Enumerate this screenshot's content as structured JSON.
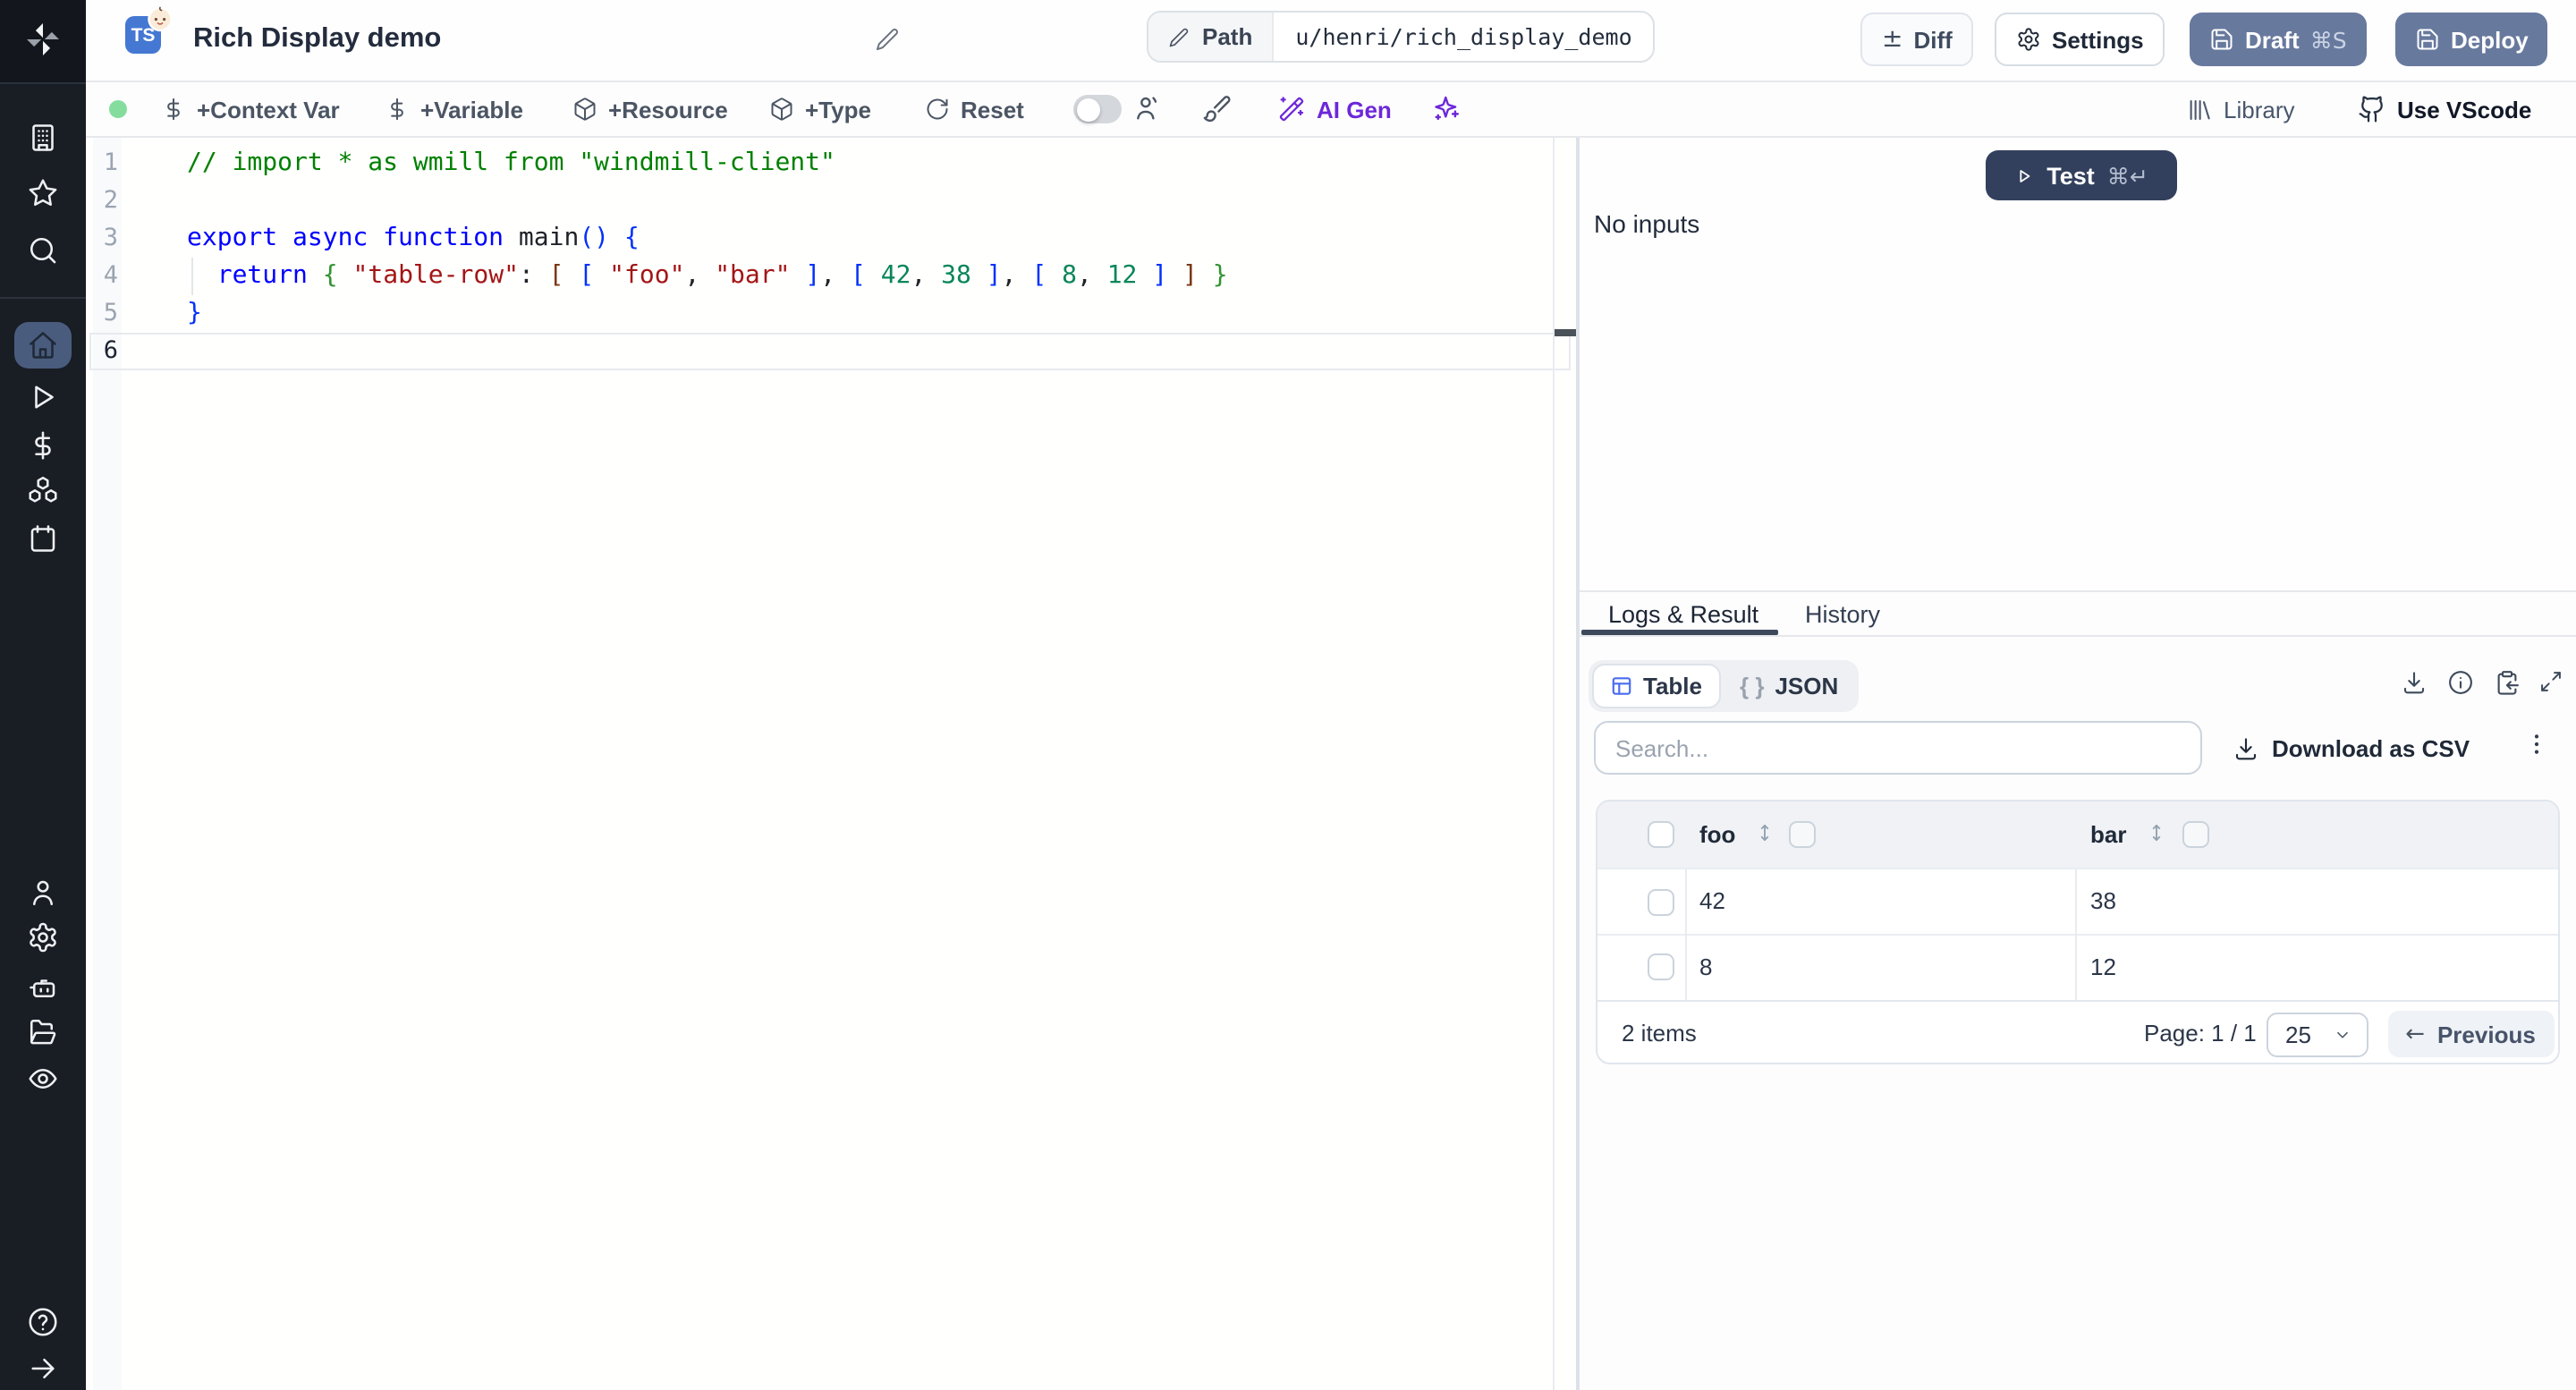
{
  "header": {
    "language_badge": "TS",
    "title": "Rich Display demo",
    "path_label": "Path",
    "path_value": "u/henri/rich_display_demo",
    "diff_label": "Diff",
    "settings_label": "Settings",
    "draft_label": "Draft",
    "draft_shortcut": "⌘S",
    "deploy_label": "Deploy"
  },
  "toolbar": {
    "add_context_var": "+Context Var",
    "add_variable": "+Variable",
    "add_resource": "+Resource",
    "add_type": "+Type",
    "reset": "Reset",
    "ai_gen": "AI Gen",
    "library": "Library",
    "use_vscode": "Use VScode"
  },
  "sidebar": {
    "items": [
      "windmill-logo",
      "workspace",
      "favorites",
      "search",
      "home",
      "runs",
      "variables",
      "resources",
      "schedules",
      "users",
      "settings",
      "workers",
      "folders",
      "audit-logs",
      "help",
      "collapse"
    ]
  },
  "colors": {
    "ai_accent": "#6d28d9",
    "slate_button": "#68799e",
    "test_button": "#33405d",
    "ts_badge_blue": "#4478d2",
    "status_green": "#84dd9d",
    "table_icon_blue": "#4a6cf0",
    "sidebar_active": "#4a5c7e"
  },
  "editor": {
    "active_line": 6,
    "lines": [
      {
        "num": 1,
        "tokens": [
          {
            "c": "cmt",
            "t": "// import * as wmill from \"windmill-client\""
          }
        ]
      },
      {
        "num": 2,
        "tokens": []
      },
      {
        "num": 3,
        "tokens": [
          {
            "c": "kw",
            "t": "export async function "
          },
          {
            "c": "plain",
            "t": "main"
          },
          {
            "c": "b1",
            "t": "()"
          },
          {
            "c": "plain",
            "t": " "
          },
          {
            "c": "b1",
            "t": "{"
          }
        ]
      },
      {
        "num": 4,
        "tokens": [
          {
            "c": "plain",
            "t": "  "
          },
          {
            "c": "kw",
            "t": "return"
          },
          {
            "c": "plain",
            "t": " "
          },
          {
            "c": "b2",
            "t": "{"
          },
          {
            "c": "plain",
            "t": " "
          },
          {
            "c": "str",
            "t": "\"table-row\""
          },
          {
            "c": "plain",
            "t": ": "
          },
          {
            "c": "b3",
            "t": "["
          },
          {
            "c": "plain",
            "t": " "
          },
          {
            "c": "b1",
            "t": "["
          },
          {
            "c": "plain",
            "t": " "
          },
          {
            "c": "str",
            "t": "\"foo\""
          },
          {
            "c": "plain",
            "t": ", "
          },
          {
            "c": "str",
            "t": "\"bar\""
          },
          {
            "c": "plain",
            "t": " "
          },
          {
            "c": "b1",
            "t": "]"
          },
          {
            "c": "plain",
            "t": ", "
          },
          {
            "c": "b1",
            "t": "["
          },
          {
            "c": "plain",
            "t": " "
          },
          {
            "c": "num",
            "t": "42"
          },
          {
            "c": "plain",
            "t": ", "
          },
          {
            "c": "num",
            "t": "38"
          },
          {
            "c": "plain",
            "t": " "
          },
          {
            "c": "b1",
            "t": "]"
          },
          {
            "c": "plain",
            "t": ", "
          },
          {
            "c": "b1",
            "t": "["
          },
          {
            "c": "plain",
            "t": " "
          },
          {
            "c": "num",
            "t": "8"
          },
          {
            "c": "plain",
            "t": ", "
          },
          {
            "c": "num",
            "t": "12"
          },
          {
            "c": "plain",
            "t": " "
          },
          {
            "c": "b1",
            "t": "]"
          },
          {
            "c": "plain",
            "t": " "
          },
          {
            "c": "b3",
            "t": "]"
          },
          {
            "c": "plain",
            "t": " "
          },
          {
            "c": "b2",
            "t": "}"
          }
        ]
      },
      {
        "num": 5,
        "tokens": [
          {
            "c": "b1",
            "t": "}"
          }
        ]
      },
      {
        "num": 6,
        "tokens": []
      }
    ]
  },
  "run_panel": {
    "test_label": "Test",
    "test_shortcut": "⌘↵",
    "empty_text": "No inputs"
  },
  "result_panel": {
    "tabs": [
      {
        "label": "Logs & Result",
        "active": true
      },
      {
        "label": "History",
        "active": false
      }
    ],
    "view_modes": [
      {
        "label": "Table",
        "active": true
      },
      {
        "label": "JSON",
        "active": false
      }
    ],
    "braces_glyph": "{ }",
    "search_placeholder": "Search...",
    "download_csv_label": "Download as CSV",
    "table": {
      "columns": [
        "foo",
        "bar"
      ],
      "rows": [
        [
          "42",
          "38"
        ],
        [
          "8",
          "12"
        ]
      ],
      "items_text": "2 items",
      "page_text": "Page: 1 / 1",
      "page_size": "25",
      "previous_label": "Previous"
    }
  }
}
